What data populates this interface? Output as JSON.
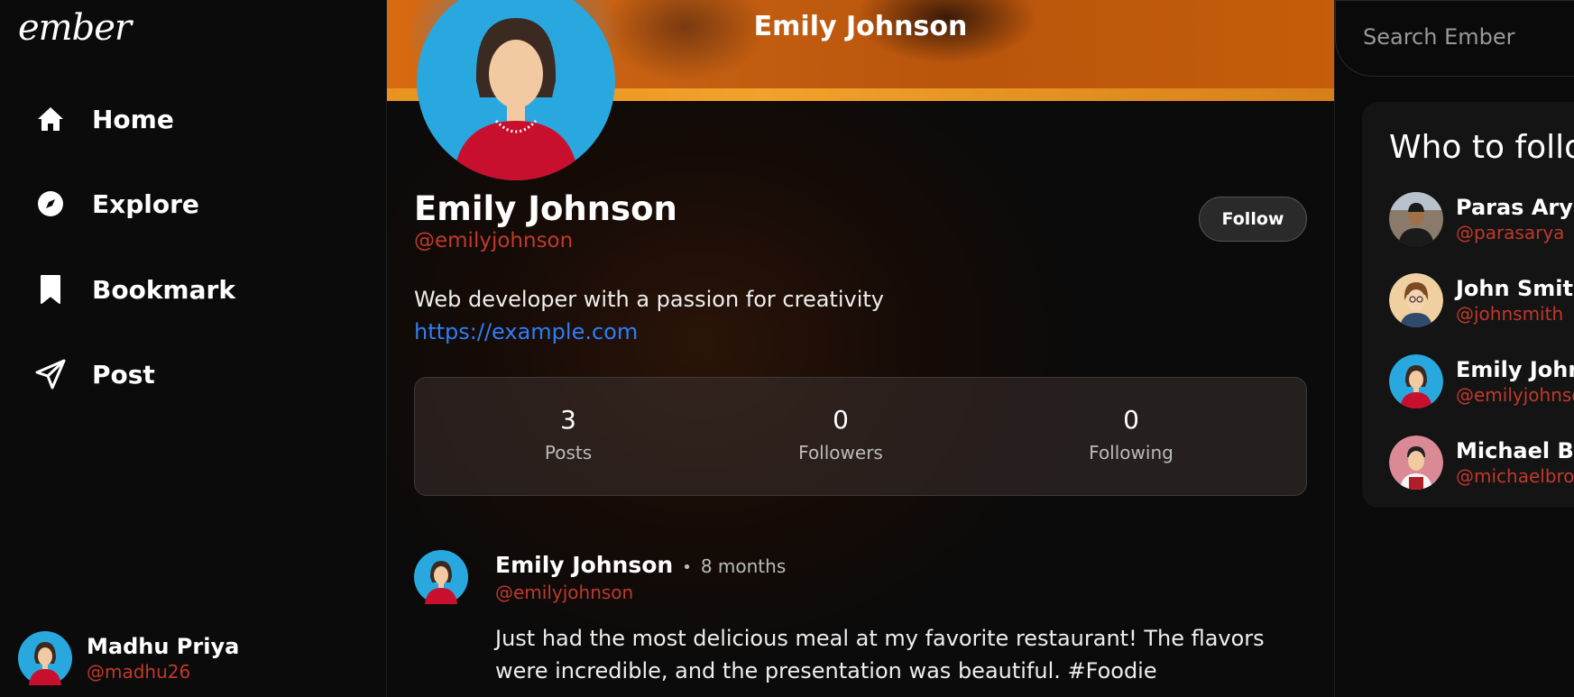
{
  "app": {
    "logo": "ember"
  },
  "nav": [
    {
      "label": "Home",
      "icon": "home-icon"
    },
    {
      "label": "Explore",
      "icon": "compass-icon"
    },
    {
      "label": "Bookmark",
      "icon": "bookmark-icon"
    },
    {
      "label": "Post",
      "icon": "send-icon"
    }
  ],
  "current_user": {
    "name": "Madhu Priya",
    "handle": "@madhu26"
  },
  "header": {
    "title": "Emily Johnson"
  },
  "profile": {
    "name": "Emily Johnson",
    "handle": "@emilyjohnson",
    "follow_label": "Follow",
    "bio": "Web developer with a passion for creativity",
    "link": "https://example.com",
    "stats": [
      {
        "value": "3",
        "label": "Posts"
      },
      {
        "value": "0",
        "label": "Followers"
      },
      {
        "value": "0",
        "label": "Following"
      }
    ]
  },
  "post": {
    "author": "Emily Johnson",
    "separator": "•",
    "time": "8 months",
    "handle": "@emilyjohnson",
    "text": "Just had the most delicious meal at my favorite restaurant! The flavors were incredible, and the presentation was beautiful. #Foodie"
  },
  "search": {
    "placeholder": "Search Ember"
  },
  "who_to_follow": {
    "title": "Who to follow",
    "items": [
      {
        "name": "Paras Arya",
        "handle": "@parasarya"
      },
      {
        "name": "John Smith",
        "handle": "@johnsmith"
      },
      {
        "name": "Emily Johnson",
        "handle": "@emilyjohnson"
      },
      {
        "name": "Michael Brown",
        "handle": "@michaelbrown"
      }
    ]
  },
  "colors": {
    "accent_handle": "#c0392b",
    "link": "#2f7df6",
    "banner": "#d86a10"
  }
}
